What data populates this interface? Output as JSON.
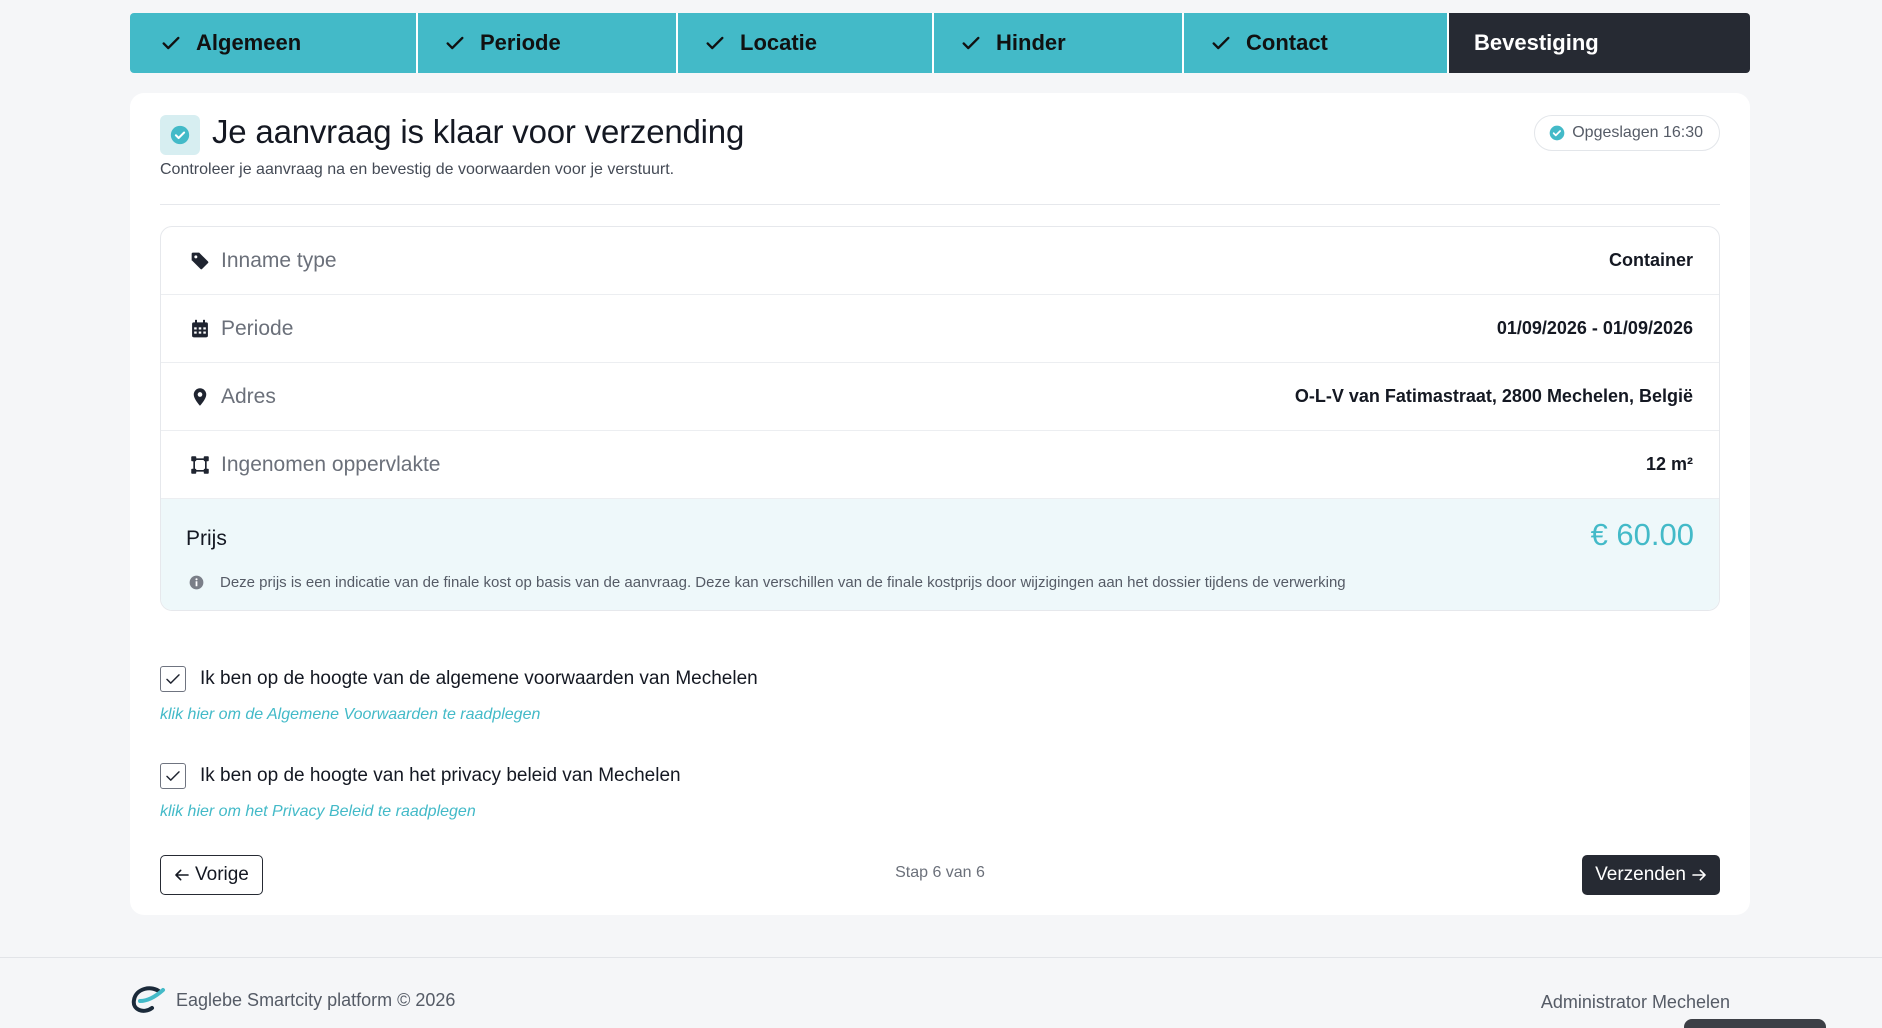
{
  "colors": {
    "accent": "#43bac8",
    "dark": "#262a33",
    "price_bg": "#eef8fa"
  },
  "stepper": {
    "steps": [
      {
        "label": "Algemeen",
        "done": true
      },
      {
        "label": "Periode",
        "done": true
      },
      {
        "label": "Locatie",
        "done": true
      },
      {
        "label": "Hinder",
        "done": true
      },
      {
        "label": "Contact",
        "done": true
      },
      {
        "label": "Bevestiging",
        "done": false,
        "active": true
      }
    ]
  },
  "header": {
    "title": "Je aanvraag is klaar voor verzending",
    "subtitle": "Controleer je aanvraag na en bevestig de voorwaarden voor je verstuurt.",
    "saved_label": "Opgeslagen 16:30"
  },
  "summary": {
    "rows": [
      {
        "icon": "tag-icon",
        "label": "Inname type",
        "value": "Container"
      },
      {
        "icon": "calendar-icon",
        "label": "Periode",
        "value": "01/09/2026 - 01/09/2026"
      },
      {
        "icon": "map-pin-icon",
        "label": "Adres",
        "value": "O-L-V van Fatimastraat, 2800 Mechelen, België"
      },
      {
        "icon": "area-icon",
        "label": "Ingenomen oppervlakte",
        "value": "12 m²"
      }
    ],
    "price": {
      "label": "Prijs",
      "value": "€ 60.00",
      "note": "Deze prijs is een indicatie van de finale kost op basis van de aanvraag. Deze kan verschillen van de finale kostprijs door wijzigingen aan het dossier tijdens de verwerking"
    }
  },
  "agreements": [
    {
      "text": "Ik ben op de hoogte van de algemene voorwaarden van Mechelen",
      "link": "klik hier om de Algemene Voorwaarden te raadplegen",
      "checked": true
    },
    {
      "text": "Ik ben op de hoogte van het privacy beleid van Mechelen",
      "link": "klik hier om het Privacy Beleid te raadplegen",
      "checked": true
    }
  ],
  "navigation": {
    "prev_label": "Vorige",
    "step_indicator": "Stap 6 van 6",
    "next_label": "Verzenden"
  },
  "footer": {
    "platform": "Eaglebe Smartcity platform © 2026",
    "user": "Administrator Mechelen"
  }
}
